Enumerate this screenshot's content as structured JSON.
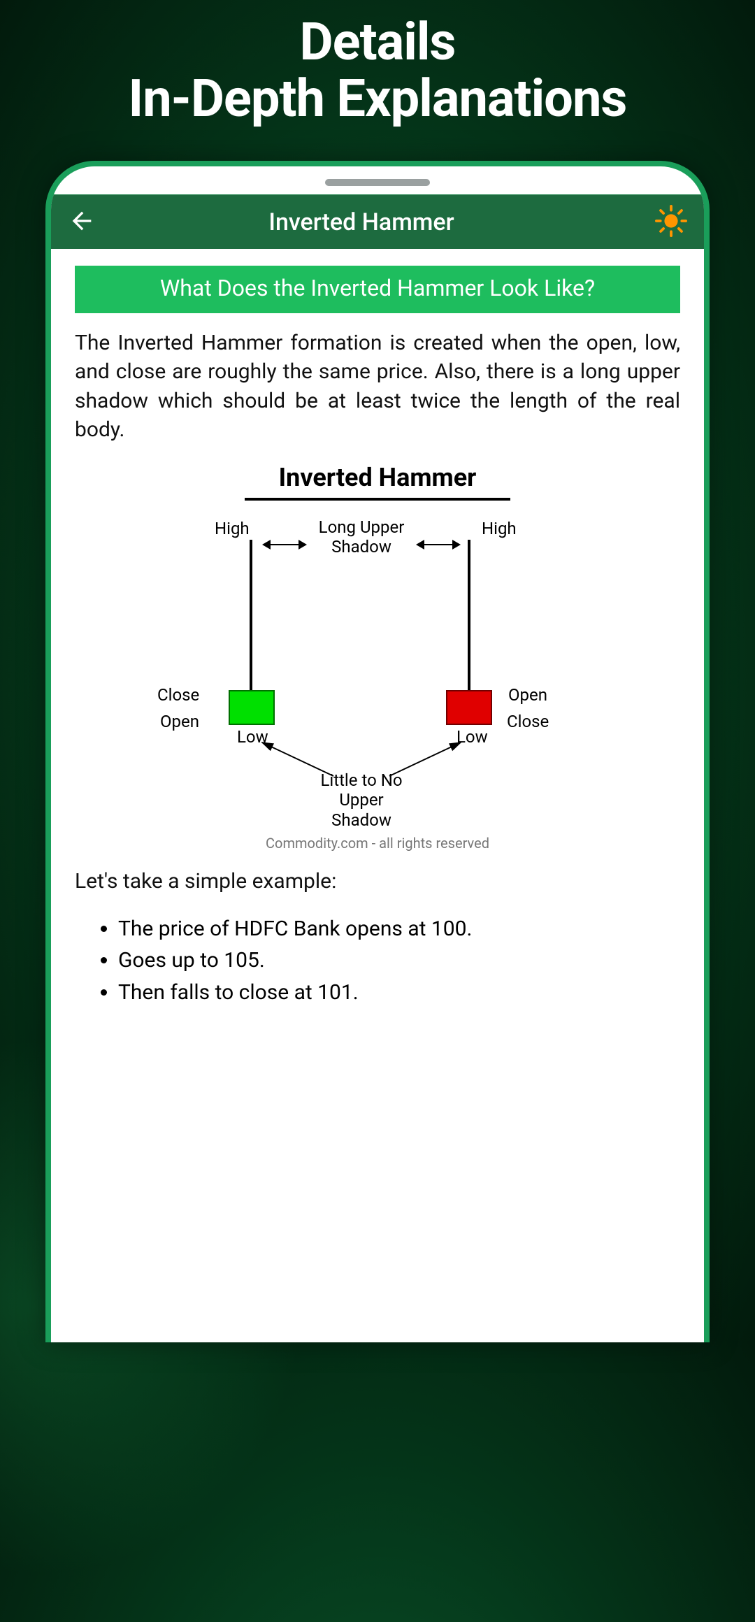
{
  "promo": {
    "line1": "Details",
    "line2": "In-Depth Explanations"
  },
  "header": {
    "title": "Inverted Hammer"
  },
  "section_heading": "What Does the Inverted Hammer Look Like?",
  "paragraph1": "The Inverted Hammer formation is created when the open, low, and close are roughly the same price. Also, there is a long upper shadow which should be at least twice the length of the real body.",
  "diagram": {
    "title": "Inverted Hammer",
    "labels": {
      "high_left": "High",
      "high_right": "High",
      "long_upper_shadow": "Long Upper\nShadow",
      "close": "Close",
      "open_left": "Open",
      "open_right": "Open",
      "close_right": "Close",
      "low_left": "Low",
      "low_right": "Low",
      "little_shadow": "Little to No\nUpper\nShadow"
    },
    "credit": "Commodity.com - all rights reserved"
  },
  "example_intro": "Let's take a simple example:",
  "example_list": [
    "The price of HDFC Bank opens at 100.",
    "Goes up to 105.",
    "Then falls to close at 101."
  ],
  "icons": {
    "back": "arrow-left-icon",
    "theme": "sun-icon"
  }
}
